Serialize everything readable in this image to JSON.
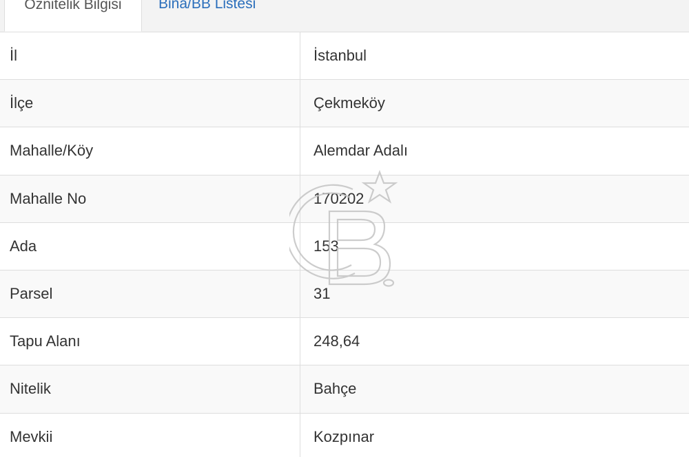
{
  "tabs": [
    {
      "label": "Öznitelik Bilgisi",
      "active": true
    },
    {
      "label": "Bina/BB Listesi",
      "active": false
    }
  ],
  "rows": [
    {
      "label": "İl",
      "value": "İstanbul"
    },
    {
      "label": "İlçe",
      "value": "Çekmeköy"
    },
    {
      "label": "Mahalle/Köy",
      "value": "Alemdar Adalı"
    },
    {
      "label": "Mahalle No",
      "value": "170202"
    },
    {
      "label": "Ada",
      "value": "153"
    },
    {
      "label": "Parsel",
      "value": "31"
    },
    {
      "label": "Tapu Alanı",
      "value": "248,64"
    },
    {
      "label": "Nitelik",
      "value": "Bahçe"
    },
    {
      "label": "Mevkii",
      "value": "Kozpınar"
    }
  ],
  "watermark": {
    "icon": "cb-logo-watermark-icon",
    "color": "#c8c8c8"
  },
  "colors": {
    "link": "#2a6ebb",
    "text": "#333333",
    "border": "#dddddd",
    "stripe": "#f9f9f9"
  }
}
